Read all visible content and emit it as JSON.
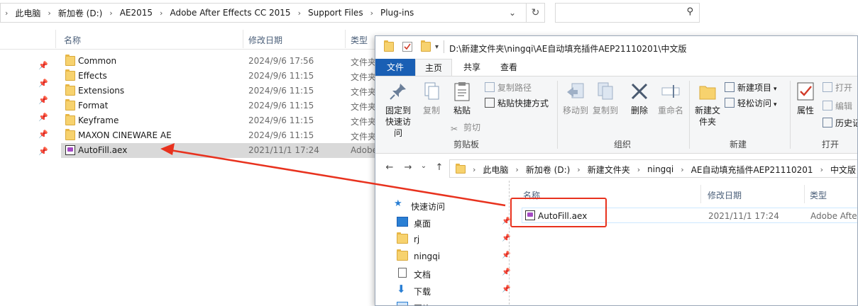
{
  "back_window": {
    "breadcrumb": [
      "此电脑",
      "新加卷 (D:)",
      "AE2015",
      "Adobe After Effects CC 2015",
      "Support Files",
      "Plug-ins"
    ],
    "search_placeholder": "",
    "columns": {
      "name": "名称",
      "date": "修改日期",
      "type": "类型"
    },
    "rows": [
      {
        "name": "Common",
        "date": "2024/9/6 17:56",
        "type": "文件夹",
        "kind": "folder"
      },
      {
        "name": "Effects",
        "date": "2024/9/6 11:15",
        "type": "文件夹",
        "kind": "folder"
      },
      {
        "name": "Extensions",
        "date": "2024/9/6 11:15",
        "type": "文件夹",
        "kind": "folder"
      },
      {
        "name": "Format",
        "date": "2024/9/6 11:15",
        "type": "文件夹",
        "kind": "folder"
      },
      {
        "name": "Keyframe",
        "date": "2024/9/6 11:15",
        "type": "文件夹",
        "kind": "folder"
      },
      {
        "name": "MAXON CINEWARE AE",
        "date": "2024/9/6 11:15",
        "type": "文件夹",
        "kind": "folder"
      },
      {
        "name": "AutoFill.aex",
        "date": "2021/11/1 17:24",
        "type": "Adobe",
        "kind": "aex"
      }
    ]
  },
  "front_window": {
    "title": "D:\\新建文件夹\\ningqi\\AE自动填充插件AEP21110201\\中文版",
    "tabs": {
      "file": "文件",
      "home": "主页",
      "share": "共享",
      "view": "查看"
    },
    "ribbon": {
      "pin_quick_access": "固定到快速访问",
      "copy": "复制",
      "paste": "粘贴",
      "copy_path": "复制路径",
      "paste_shortcut": "粘贴快捷方式",
      "cut": "剪切",
      "clipboard_group": "剪贴板",
      "move_to": "移动到",
      "copy_to": "复制到",
      "delete": "删除",
      "rename": "重命名",
      "organize_group": "组织",
      "new_folder": "新建文件夹",
      "new_item": "新建项目",
      "easy_access": "轻松访问",
      "new_group": "新建",
      "properties": "属性",
      "open": "打开",
      "edit": "编辑",
      "history": "历史记",
      "open_group": "打开"
    },
    "breadcrumb": [
      "此电脑",
      "新加卷 (D:)",
      "新建文件夹",
      "ningqi",
      "AE自动填充插件AEP21110201",
      "中文版"
    ],
    "sidebar": [
      {
        "label": "快速访问",
        "icon": "star-icon"
      },
      {
        "label": "桌面",
        "icon": "desktop-icon"
      },
      {
        "label": "rj",
        "icon": "folder-icon"
      },
      {
        "label": "ningqi",
        "icon": "folder-icon"
      },
      {
        "label": "文档",
        "icon": "document-icon"
      },
      {
        "label": "下载",
        "icon": "download-icon"
      },
      {
        "label": "图片",
        "icon": "picture-icon"
      }
    ],
    "columns": {
      "name": "名称",
      "date": "修改日期",
      "type": "类型"
    },
    "file": {
      "name": "AutoFill.aex",
      "date": "2021/11/1 17:24",
      "type": "Adobe After"
    }
  },
  "colors": {
    "accent": "#1a5fb4",
    "annotation": "#e8321e"
  }
}
